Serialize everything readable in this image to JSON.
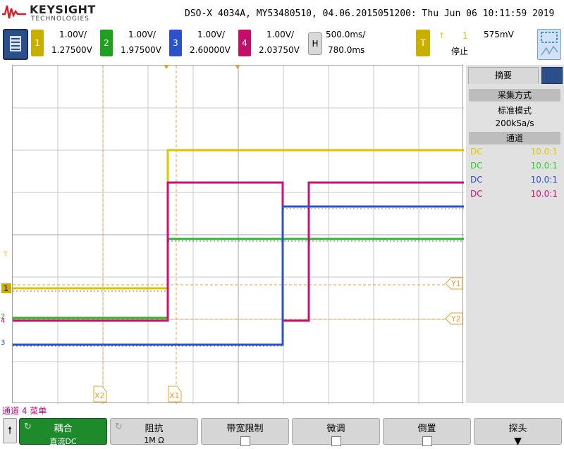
{
  "header": {
    "brand": "KEYSIGHT",
    "brand_sub": "TECHNOLOGIES",
    "title": "DSO-X 4034A, MY53480510, 04.06.2015051200: Thu Jun 06 10:11:59 2019"
  },
  "channels": [
    {
      "num": "1",
      "scale": "1.00V/",
      "offset": "1.27500V",
      "color": "#c9b000"
    },
    {
      "num": "2",
      "scale": "1.00V/",
      "offset": "1.97500V",
      "color": "#1fa01f"
    },
    {
      "num": "3",
      "scale": "1.00V/",
      "offset": "2.60000V",
      "color": "#2b52c9"
    },
    {
      "num": "4",
      "scale": "1.00V/",
      "offset": "2.03750V",
      "color": "#c0106a"
    }
  ],
  "horizontal": {
    "label": "H",
    "scale": "500.0ms/",
    "delay": "780.0ms"
  },
  "trigger": {
    "label": "T",
    "flag": "↑",
    "source": "1",
    "level": "575mV",
    "status": "停止"
  },
  "cursors": {
    "x1": "X1",
    "x2": "X2",
    "y1": "Y1",
    "y2": "Y2"
  },
  "markers": {
    "trig": "T",
    "ch1": "1",
    "ch2": "2",
    "ch3": "3",
    "ch4": "4"
  },
  "panel": {
    "tab": "摘要",
    "acq_heading": "采集方式",
    "acq_mode": "标准模式",
    "sample_rate": "200kSa/s",
    "ch_heading": "通道",
    "rows": [
      {
        "coupling": "DC",
        "probe": "10.0:1",
        "color": "#e0c800"
      },
      {
        "coupling": "DC",
        "probe": "10.0:1",
        "color": "#2fd02f"
      },
      {
        "coupling": "DC",
        "probe": "10.0:1",
        "color": "#2b52c9"
      },
      {
        "coupling": "DC",
        "probe": "10.0:1",
        "color": "#d0107a"
      }
    ]
  },
  "menu": {
    "title": "通道 4 菜单",
    "keys": [
      {
        "label": "耦合",
        "value": "直流DC"
      },
      {
        "label": "阻抗",
        "value": "1M Ω"
      },
      {
        "label": "带宽限制",
        "value": ""
      },
      {
        "label": "微调",
        "value": ""
      },
      {
        "label": "倒置",
        "value": ""
      },
      {
        "label": "探头",
        "value": ""
      }
    ]
  },
  "colors": {
    "accent": "#2b4f8c",
    "active_key": "#1f8a2c"
  }
}
